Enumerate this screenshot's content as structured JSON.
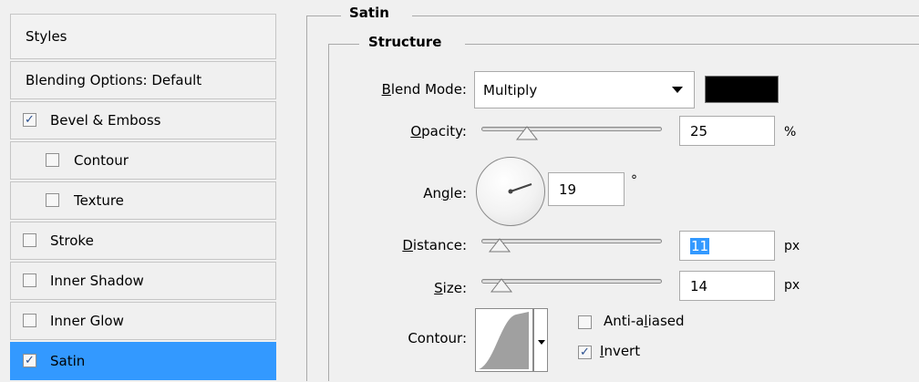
{
  "styles_list": {
    "header": "Styles",
    "blending_options": "Blending Options: Default",
    "items": [
      {
        "label": "Bevel & Emboss",
        "checked": true
      },
      {
        "label": "Contour",
        "checked": false
      },
      {
        "label": "Texture",
        "checked": false
      },
      {
        "label": "Stroke",
        "checked": false
      },
      {
        "label": "Inner Shadow",
        "checked": false
      },
      {
        "label": "Inner Glow",
        "checked": false
      },
      {
        "label": "Satin",
        "checked": true
      }
    ]
  },
  "panel": {
    "section_title": "Satin",
    "group_title": "Structure",
    "blend_mode": {
      "label_u": "B",
      "label_rest": "lend Mode:",
      "value": "Multiply",
      "color": "#000000"
    },
    "opacity": {
      "label_u": "O",
      "label_rest": "pacity:",
      "value": "25",
      "unit": "%",
      "level": 0.25
    },
    "angle": {
      "label_pre": "An",
      "label_u": "g",
      "label_rest": "le:",
      "value": "19",
      "unit": "°"
    },
    "distance": {
      "label_u": "D",
      "label_rest": "istance:",
      "value": "11",
      "unit": "px"
    },
    "size": {
      "label_u": "S",
      "label_rest": "ize:",
      "value": "14",
      "unit": "px"
    },
    "contour": {
      "label": "Contour:",
      "anti_aliased": {
        "label_pre": "Anti-a",
        "label_u": "l",
        "label_rest": "iased",
        "checked": false
      },
      "invert": {
        "label_u": "I",
        "label_rest": "nvert",
        "checked": true
      }
    }
  },
  "icons": [
    "chevron-down-icon",
    "angle-dial-icon",
    "contour-curve-icon",
    "checkbox-icon"
  ]
}
